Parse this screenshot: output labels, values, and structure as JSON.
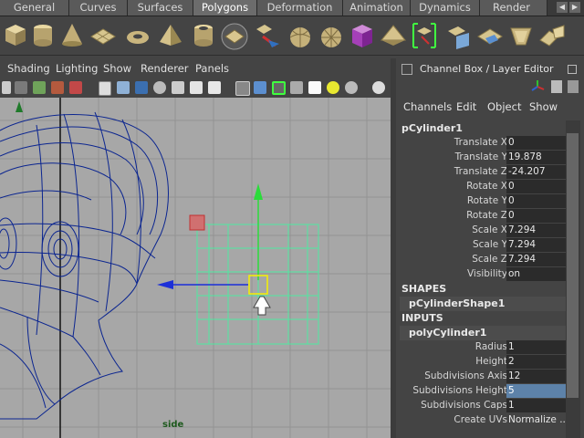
{
  "shelf": {
    "tabs": [
      {
        "label": "General",
        "active": false
      },
      {
        "label": "Curves",
        "active": false
      },
      {
        "label": "Surfaces",
        "active": false
      },
      {
        "label": "Polygons",
        "active": true
      },
      {
        "label": "Deformation",
        "active": false
      },
      {
        "label": "Animation",
        "active": false
      },
      {
        "label": "Dynamics",
        "active": false
      },
      {
        "label": "Render",
        "active": false
      }
    ],
    "icons": [
      "cube-icon",
      "cylinder-icon",
      "cone-icon",
      "plane-icon",
      "torus-icon",
      "pyramid-icon",
      "pipe-icon",
      "helix-icon",
      "soccer-ball-icon",
      "sphere-icon",
      "platonic-icon",
      "box-icon",
      "plane-icon",
      "selected-tool-icon",
      "uv-icon",
      "extrude-icon",
      "bevel-icon",
      "merge-icon"
    ]
  },
  "viewport": {
    "menu": [
      "Shading",
      "Lighting",
      "Show",
      "Renderer",
      "Panels"
    ],
    "camera_label": "side"
  },
  "channel_box": {
    "title": "Channel Box / Layer Editor",
    "menu": [
      "Channels",
      "Edit",
      "Object",
      "Show"
    ],
    "object_name": "pCylinder1",
    "transform": [
      {
        "label": "Translate X",
        "value": "0"
      },
      {
        "label": "Translate Y",
        "value": "19.878"
      },
      {
        "label": "Translate Z",
        "value": "-24.207"
      },
      {
        "label": "Rotate X",
        "value": "0"
      },
      {
        "label": "Rotate Y",
        "value": "0"
      },
      {
        "label": "Rotate Z",
        "value": "0"
      },
      {
        "label": "Scale X",
        "value": "7.294"
      },
      {
        "label": "Scale Y",
        "value": "7.294"
      },
      {
        "label": "Scale Z",
        "value": "7.294"
      },
      {
        "label": "Visibility",
        "value": "on"
      }
    ],
    "shapes_header": "SHAPES",
    "shape_name": "pCylinderShape1",
    "inputs_header": "INPUTS",
    "input_name": "polyCylinder1",
    "inputs": [
      {
        "label": "Radius",
        "value": "1"
      },
      {
        "label": "Height",
        "value": "2"
      },
      {
        "label": "Subdivisions Axis",
        "value": "12"
      },
      {
        "label": "Subdivisions Height",
        "value": "5",
        "selected": true
      },
      {
        "label": "Subdivisions Caps",
        "value": "1"
      },
      {
        "label": "Create UVs",
        "value": "Normalize ..."
      }
    ]
  }
}
